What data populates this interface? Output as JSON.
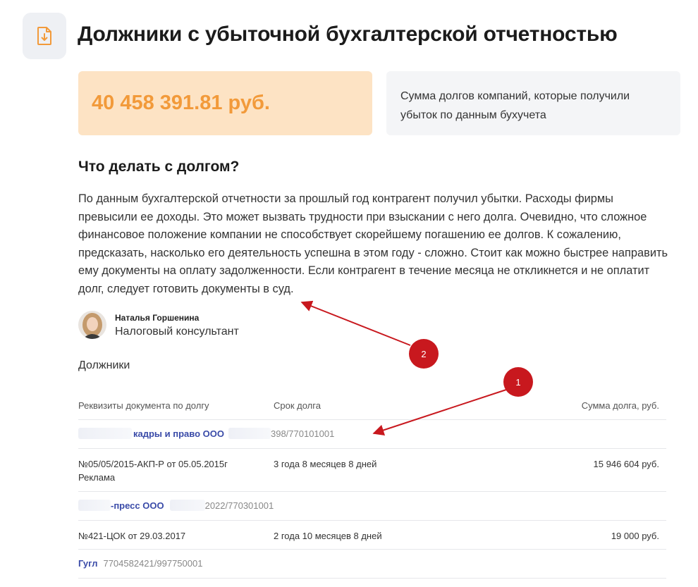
{
  "page": {
    "title": "Должники с убыточной бухгалтерской отчетностью",
    "icon": "download-document-icon"
  },
  "summary": {
    "total_amount": "40 458 391.81 руб.",
    "description": "Сумма долгов компаний, которые получили убыток по данным бухучета",
    "amount_color": "#f29a3a",
    "amount_bg": "#fde3c4"
  },
  "advice": {
    "heading": "Что делать с долгом?",
    "text": "По данным бухгалтерской отчетности за прошлый год контрагент получил убытки. Расходы фирмы превысили ее доходы. Это может вызвать трудности при взыскании с него долга. Очевидно, что сложное финансовое положение компании не способствует скорейшему погашению ее долгов. К сожалению, предсказать, насколько его деятельность успешна в этом году - сложно. Стоит как можно быстрее направить ему документы на оплату задолженности. Если контрагент в течение месяца не откликнется и не оплатит долг, следует готовить документы в суд."
  },
  "consultant": {
    "name": "Наталья Горшенина",
    "role": "Налоговый консультант"
  },
  "debtors": {
    "heading": "Должники",
    "columns": {
      "document": "Реквизиты документа по долгу",
      "term": "Срок долга",
      "amount": "Сумма долга, руб."
    },
    "companies": [
      {
        "name": "кадры и право ООО",
        "inn": "398/770101001",
        "debts": [
          {
            "document": "№05/05/2015-АКП-Р от 05.05.2015г",
            "note": "Реклама",
            "term": "3 года 8 месяцев 8 дней",
            "amount": "15 946 604 руб."
          }
        ]
      },
      {
        "name": "-пресс ООО",
        "inn": "2022/770301001",
        "debts": [
          {
            "document": "№421-ЦОК от 29.03.2017",
            "note": "",
            "term": "2 года 10 месяцев 8 дней",
            "amount": "19 000 руб."
          }
        ]
      },
      {
        "name": "Гугл",
        "inn": "7704582421/997750001",
        "debts": []
      }
    ]
  },
  "annotations": {
    "marker_1": "1",
    "marker_2": "2",
    "marker_color": "#c8181e"
  }
}
